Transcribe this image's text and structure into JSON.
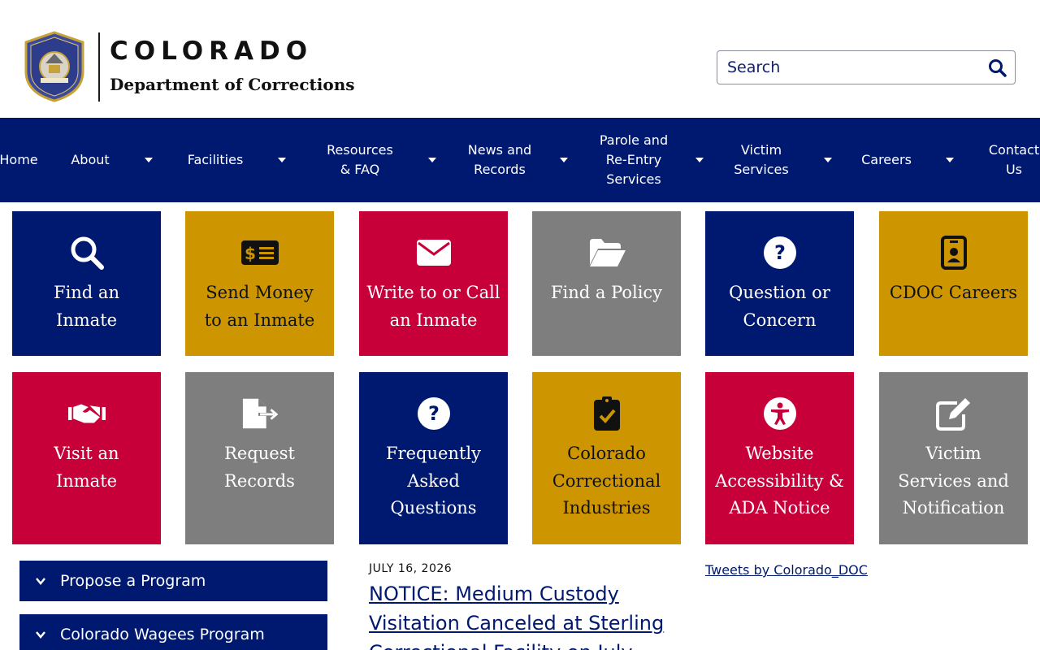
{
  "header": {
    "seal_text": "COLORADO DEPARTMENT OF CORRECTIONS",
    "brand_title": "COLORADO",
    "brand_subtitle": "Department of Corrections"
  },
  "search": {
    "placeholder": "Search",
    "icon": "search-icon"
  },
  "nav": {
    "items": [
      {
        "label": "Home",
        "has_dropdown": false
      },
      {
        "label": "About",
        "has_dropdown": true
      },
      {
        "label": "Facilities",
        "has_dropdown": true
      },
      {
        "label": "Resources\n& FAQ",
        "has_dropdown": true
      },
      {
        "label": "News and\nRecords",
        "has_dropdown": true
      },
      {
        "label": "Parole and\nRe-Entry\nServices",
        "has_dropdown": true
      },
      {
        "label": "Victim\nServices",
        "has_dropdown": true
      },
      {
        "label": "Careers",
        "has_dropdown": true
      },
      {
        "label": "Contact\nUs",
        "has_dropdown": false
      }
    ]
  },
  "tiles": [
    {
      "label": "Find an Inmate",
      "icon": "magnifier-icon",
      "color": "navy"
    },
    {
      "label": "Send Money to an Inmate",
      "icon": "money-check-icon",
      "color": "gold"
    },
    {
      "label": "Write to or Call an Inmate",
      "icon": "envelope-icon",
      "color": "red"
    },
    {
      "label": "Find a Policy",
      "icon": "folder-open-icon",
      "color": "gray"
    },
    {
      "label": "Question or Concern",
      "icon": "question-circle-icon",
      "color": "navy"
    },
    {
      "label": "CDOC Careers",
      "icon": "id-badge-icon",
      "color": "gold"
    },
    {
      "label": "Visit an Inmate",
      "icon": "handshake-icon",
      "color": "red"
    },
    {
      "label": "Request Records",
      "icon": "file-export-icon",
      "color": "gray"
    },
    {
      "label": "Frequently Asked Questions",
      "icon": "question-circle-icon",
      "color": "navy"
    },
    {
      "label": "Colorado Correctional Industries",
      "icon": "clipboard-check-icon",
      "color": "gold"
    },
    {
      "label": "Website Accessibility & ADA Notice",
      "icon": "accessibility-icon",
      "color": "red"
    },
    {
      "label": "Victim Services and Notification",
      "icon": "edit-icon",
      "color": "gray"
    }
  ],
  "accordions": [
    {
      "label": "Propose a Program"
    },
    {
      "label": "Colorado Wagees Program"
    }
  ],
  "news": {
    "date": "JULY 16, 2026",
    "headline": "NOTICE: Medium Custody Visitation Canceled at Sterling Correctional Facility on July"
  },
  "tweets": {
    "label": "Tweets by Colorado_DOC"
  },
  "colors": {
    "navy": "#001970",
    "gold": "#cd9500",
    "red": "#c8003a",
    "gray": "#7e7e7e"
  }
}
